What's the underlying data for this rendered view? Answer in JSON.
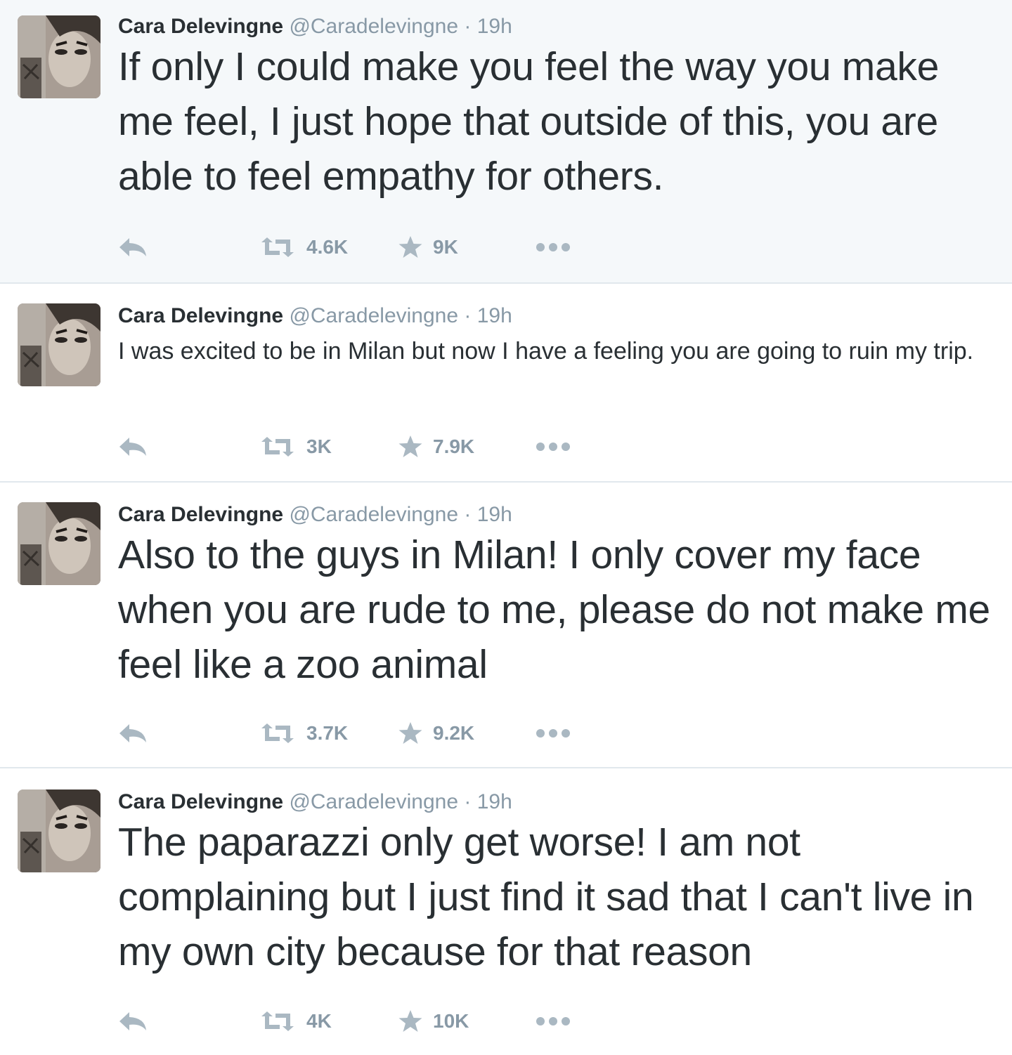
{
  "colors": {
    "name": "#292f33",
    "meta": "#8899a6",
    "icon": "#aab8c2",
    "highlight_bg": "#f5f8fa",
    "divider": "#e1e8ed"
  },
  "icons": {
    "reply": "reply-icon",
    "retweet": "retweet-icon",
    "favorite": "star-icon",
    "more": "more-dots-icon"
  },
  "tweets": [
    {
      "name": "Cara Delevingne",
      "handle": "@Caradelevingne",
      "separator": "·",
      "time": "19h",
      "text": "If only I could make you feel the way you make me feel, I just hope that outside of this, you are able to feel empathy for others.",
      "retweets": "4.6K",
      "favorites": "9K"
    },
    {
      "name": "Cara Delevingne",
      "handle": "@Caradelevingne",
      "separator": "·",
      "time": "19h",
      "text": "I was excited to be in Milan but now I have a feeling you are going to ruin my trip.",
      "retweets": "3K",
      "favorites": "7.9K"
    },
    {
      "name": "Cara Delevingne",
      "handle": "@Caradelevingne",
      "separator": "·",
      "time": "19h",
      "text": "Also to the guys in Milan! I only cover my face when you are rude to me, please do not make me feel like a zoo animal",
      "retweets": "3.7K",
      "favorites": "9.2K"
    },
    {
      "name": "Cara Delevingne",
      "handle": "@Caradelevingne",
      "separator": "·",
      "time": "19h",
      "text": "The paparazzi only get worse! I am not complaining but I just find it sad that I can't live in my own city because for that reason",
      "retweets": "4K",
      "favorites": "10K"
    }
  ]
}
